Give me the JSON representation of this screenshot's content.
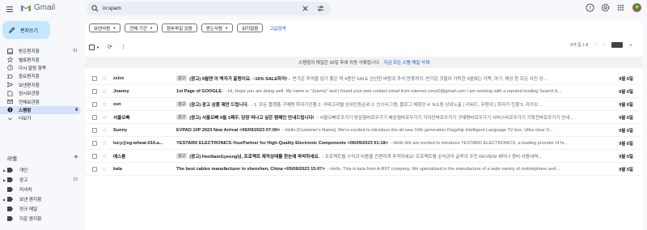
{
  "app": {
    "name": "Gmail"
  },
  "search": {
    "value": "in:spam"
  },
  "compose": {
    "label": "편지쓰기"
  },
  "sidebar": {
    "items": [
      {
        "label": "받은편지함",
        "count": "81"
      },
      {
        "label": "별표편지함",
        "count": ""
      },
      {
        "label": "다시 알림 항목",
        "count": ""
      },
      {
        "label": "중요편지함",
        "count": ""
      },
      {
        "label": "보낸편지함",
        "count": ""
      },
      {
        "label": "임시보관함",
        "count": ""
      },
      {
        "label": "전체보관함",
        "count": ""
      },
      {
        "label": "스팸함",
        "count": "8"
      },
      {
        "label": "더보기",
        "count": ""
      }
    ]
  },
  "labels": {
    "title": "라벨",
    "items": [
      {
        "label": "개인",
        "count": ""
      },
      {
        "label": "광고",
        "count": "23"
      },
      {
        "label": "리셔치",
        "count": ""
      },
      {
        "label": "보낸 편지함",
        "count": ""
      },
      {
        "label": "정크 메일",
        "count": ""
      },
      {
        "label": "지운 편지함",
        "count": ""
      }
    ]
  },
  "filters": {
    "chips": [
      "보낸사람",
      "전체 기간",
      "첨부파일 있음",
      "받는사람",
      "읽지않음"
    ],
    "advanced": "고급검색"
  },
  "pager": {
    "range": "8개 중 1-8"
  },
  "banner": {
    "text": "스팸함의 메일은 30일 후에 자동 삭제됩니다.",
    "link": "지금 모든 스팸 메일 삭제"
  },
  "emails": [
    {
      "sender": "zzixx",
      "tag": "광고",
      "subject": "(광고) 9월엔 이 액자가 출렁이요. ~16% SALE하자! -",
      "snippet": "반가운 추억을 담기 좋은 딱 4종만 SALE 선선한 바람과 추석 연휴까지, 반가운 것들이 가득한 9월에는 가족, 아기, 웨딩 등 모든 사진 앙...",
      "date": "9월 6일"
    },
    {
      "sender": "Joanny",
      "tag": "",
      "subject": "1st Page of GOOGLE.",
      "snippet": "- Hi, Hope you are doing well. My name is \"Joanny\" and I found your web contact email from internet conyi0@gmail.com I am working with a reputed leading Search E...",
      "date": "9월 6일"
    },
    {
      "sender": "zun",
      "tag": "광고",
      "subject": "(광고) 광고 상품 제안 드립니다.",
      "snippet": "- 1. 모든 플랫폼 구매평 최저가진행 2. 카테고리별 상위인증순위 3. 인스타그램, 블로그 체험단 4. N쇼핑 상위노출 ( 리워드, 우편대 ) 최저가 진행 5. 카카오...",
      "date": "9월 6일"
    },
    {
      "sender": "서울오빠",
      "tag": "광고",
      "subject": "(광고) 서울오빠 9월 1째주, 당장 떠나고 싶은 캠페인 안내드립니다!",
      "snippet": "- 서울오빠로우가기 방문형바로우가기 배송형바로우가기 가자단바로우가기 구매평바로우가기 서비스바로우가기 기획전바로우가기 안내...",
      "date": "9월 6일"
    },
    {
      "sender": "Sunny",
      "tag": "",
      "subject": "EVPAD 10P 2023 New Arrival <06/09/2023 07:00>",
      "snippet": "- Hello [Customer's Name], We're excited to introduce the all-new 10th generation Flagship Intelligent Language TV box. Ultra clear S...",
      "date": "9월 6일"
    },
    {
      "sender": "lucy@sg-wheat-010.a...",
      "tag": "",
      "subject": "YESTARD ELECTRONICS-YourPartner for High-Quality Electronic Components <06/09/2023 01:18>",
      "snippet": "- Hello We are excited to introduce YESTARD ELECTRONICS, a leading provider of hi...",
      "date": "9월 6일"
    },
    {
      "sender": "예스튠",
      "tag": "광고",
      "subject": "(광고) HeoNamGyeong님, 프로젝트 제작상태를 한눈에 파악하세요.",
      "snippet": "- 프로젝트별 수익과 비용을 간편하게 추적하세요! 프로젝트별 손익관리 글루의 주전 REVIEW 세미나 경비 사용내역...",
      "date": "9월 6일"
    },
    {
      "sender": "kala",
      "tag": "",
      "subject": "The best cables manufacturer in shenzhen, China <05/09/2023 15:07>",
      "snippet": "- Hello, This is kala from A-BST company. We specialized in the manufacture of a wide variety of mobilephone and ...",
      "date": "9월 5일"
    }
  ]
}
